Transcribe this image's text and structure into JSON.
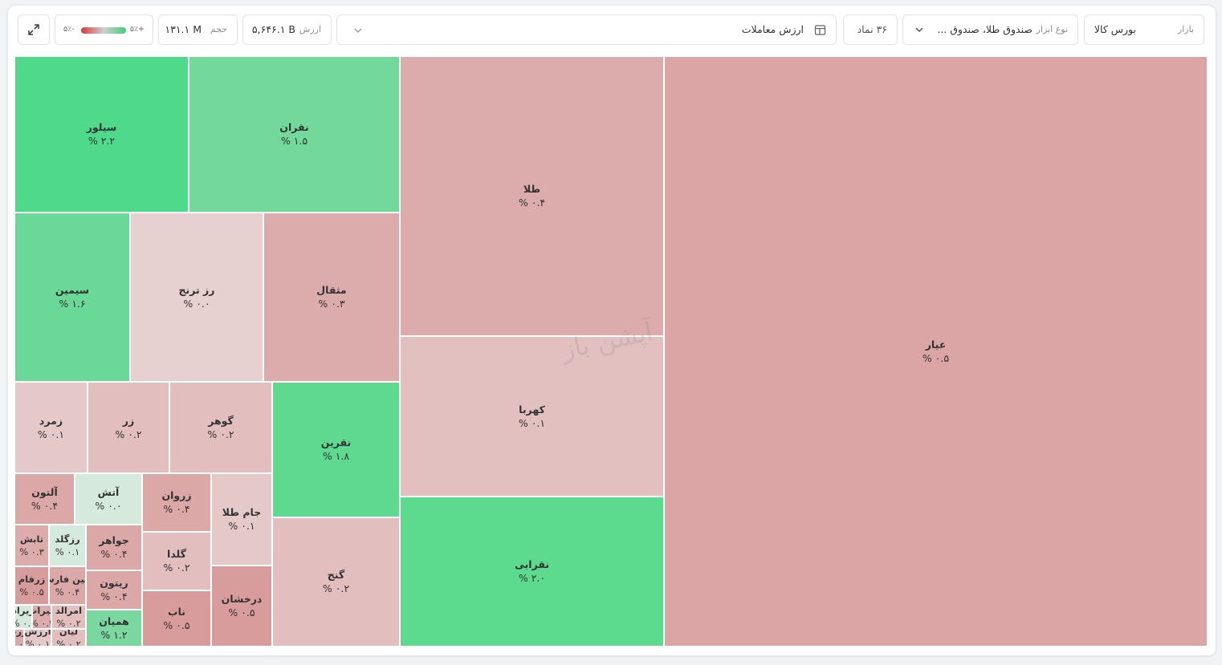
{
  "toolbar": {
    "market_label": "بازار",
    "market_value": "بورس کالا",
    "instrument_label": "نوع ابزار",
    "instrument_value": "صندوق طلا، صندوق ...",
    "symbols_count": "۳۶ نماد",
    "metric_value": "ارزش معاملات",
    "value_label": "ارزش",
    "value_amount": "۵,۶۴۶.۱ B",
    "volume_label": "حجم",
    "volume_amount": "۱۳۱.۱ M",
    "legend_min": "-۵٪",
    "legend_max": "+۵٪"
  },
  "watermark": "آپشن باز",
  "colors": {
    "strong_green": "#4fd98a",
    "green": "#72d99a",
    "light_green": "#d4eadc",
    "light_red": "#e6cfcf",
    "red": "#dba7a7",
    "strong_red": "#d99595"
  },
  "tiles": [
    {
      "name": "عیار",
      "change": "۰.۵ %"
    },
    {
      "name": "طلا",
      "change": "۰.۴ %"
    },
    {
      "name": "کهربا",
      "change": "۰.۱ %"
    },
    {
      "name": "نقرابی",
      "change": "۲.۰ %"
    },
    {
      "name": "سیلور",
      "change": "۲.۲ %"
    },
    {
      "name": "نقران",
      "change": "۱.۵ %"
    },
    {
      "name": "سیمین",
      "change": "۱.۶ %"
    },
    {
      "name": "رز ترنج",
      "change": "۰.۰ %"
    },
    {
      "name": "مثقال",
      "change": "۰.۳ %"
    },
    {
      "name": "زمرد",
      "change": "۰.۱ %"
    },
    {
      "name": "زر",
      "change": "۰.۲ %"
    },
    {
      "name": "گوهر",
      "change": "۰.۲ %"
    },
    {
      "name": "نقرین",
      "change": "۱.۸ %"
    },
    {
      "name": "گنج",
      "change": "۰.۲ %"
    },
    {
      "name": "آلتون",
      "change": "۰.۴ %"
    },
    {
      "name": "آتش",
      "change": "۰.۰ %"
    },
    {
      "name": "زروان",
      "change": "۰.۴ %"
    },
    {
      "name": "جام طلا",
      "change": "۰.۱ %"
    },
    {
      "name": "تابش",
      "change": "۰.۳ %"
    },
    {
      "name": "رزگلد",
      "change": "۰.۱ %"
    },
    {
      "name": "جواهر",
      "change": "۰.۴ %"
    },
    {
      "name": "گلدا",
      "change": "۰.۲ %"
    },
    {
      "name": "زرفام",
      "change": "۰.۵ %"
    },
    {
      "name": "نگین فارس",
      "change": "۰.۴ %"
    },
    {
      "name": "ریتون",
      "change": "۰.۴ %"
    },
    {
      "name": "ناب",
      "change": "۰.۵ %"
    },
    {
      "name": "درخشان",
      "change": "۰.۵ %"
    },
    {
      "name": "امرالد",
      "change": "۰.۲ %"
    },
    {
      "name": "همیان",
      "change": "۱.۲ %"
    },
    {
      "name": "میراث",
      "change": "۰.۳ %"
    },
    {
      "name": "زیراد",
      "change": "۰.۱ %"
    },
    {
      "name": "لیان",
      "change": "۰.۲ %"
    },
    {
      "name": "ارزش",
      "change": "۰.۱ %"
    },
    {
      "name": "زرد",
      "change": "۰.۲ %"
    }
  ]
}
